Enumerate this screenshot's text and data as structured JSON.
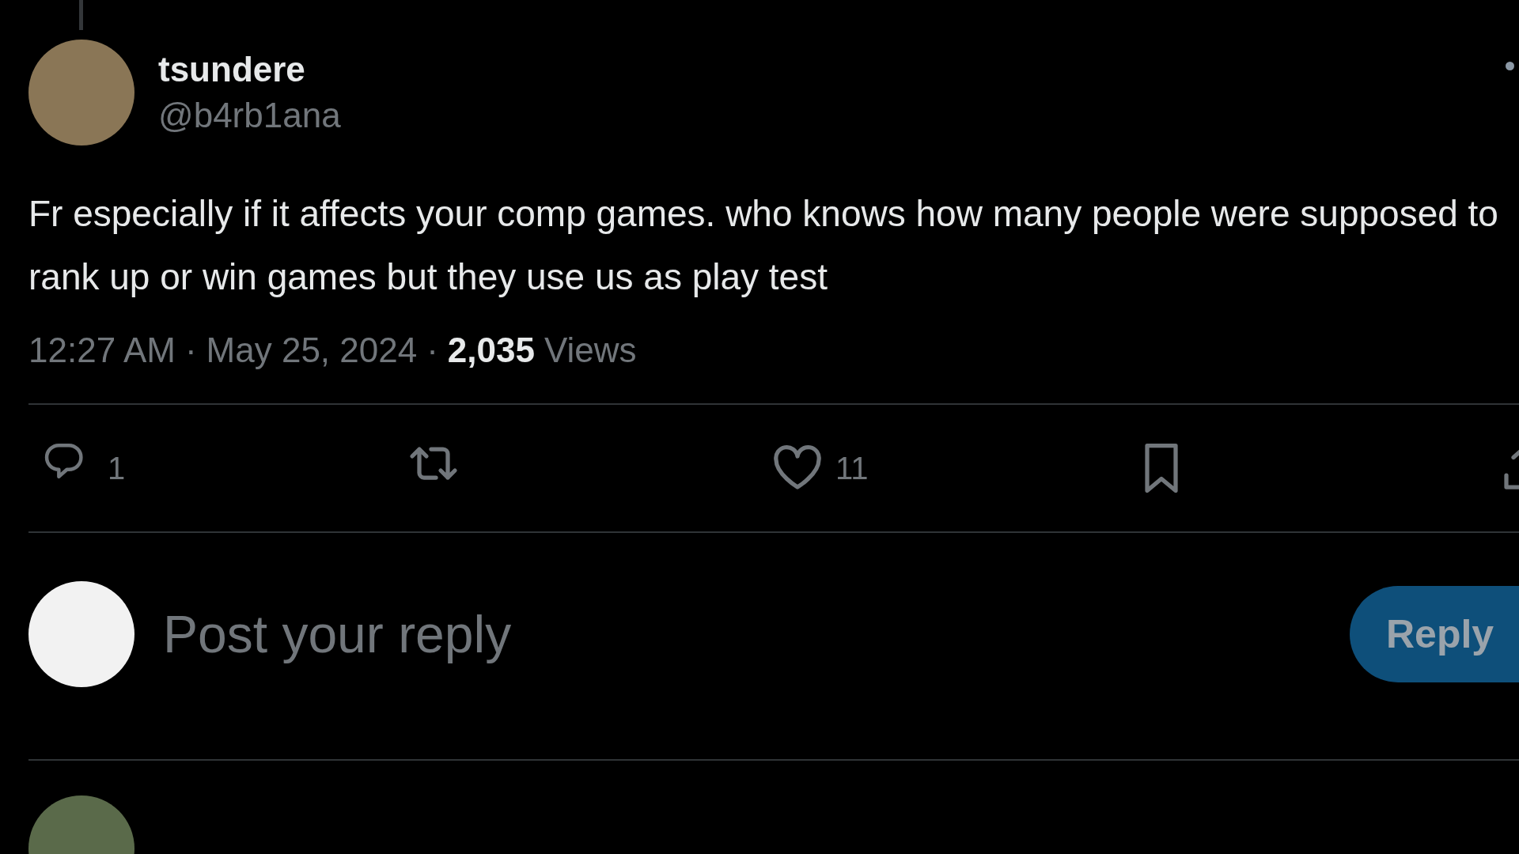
{
  "post": {
    "author": {
      "name": "tsundere",
      "handle": "@b4rb1ana"
    },
    "body": "Fr especially if it affects your comp games. who knows how many people were supposed to rank up or win games but they use us as play test",
    "meta": {
      "time": "12:27 AM",
      "separator_1": "·",
      "date": "May 25, 2024",
      "separator_2": "·",
      "views_count": "2,035",
      "views_label": "Views"
    },
    "actions": [
      {
        "kind": "reply",
        "count": "1"
      },
      {
        "kind": "repost"
      },
      {
        "kind": "like",
        "count": "11"
      },
      {
        "kind": "bookmark"
      },
      {
        "kind": "share"
      }
    ]
  },
  "reply_box": {
    "placeholder": "Post your reply",
    "button": {
      "label": "Reply",
      "disabled": true
    }
  }
}
